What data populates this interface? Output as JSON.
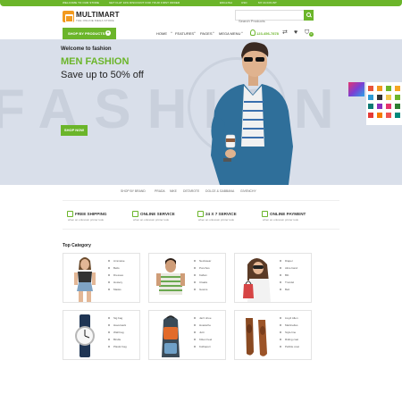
{
  "topbar": {
    "welcome": "WELCOME TO OUR STORE",
    "promo": "GET FLAT 10% DISCOUNT FOR YOUR FIRST ORDER",
    "language": "ENGLISH",
    "currency": "USD",
    "account": "MY ACCOUNT"
  },
  "header": {
    "logo_name": "MULTIMART",
    "logo_tagline": "THE ONLINE MEGA STORE",
    "search_placeholder": "Search Products"
  },
  "nav": {
    "shop_button": "SHOP BY PRODUCTS",
    "items": [
      "HOME",
      "FEATURES",
      "PAGES",
      "MEGA MENU"
    ],
    "phone": "123-456-7878",
    "cart_count": "0"
  },
  "hero": {
    "watermark": "FASHION",
    "welcome": "Welcome to fashion",
    "title": "MEN FASHION",
    "subtitle": "Save up to 50% off",
    "button": "SHOP NOW"
  },
  "swatches": [
    "#e8533a",
    "#f29a1f",
    "#6bb52a",
    "#f5a623",
    "#2b9bd6",
    "#333333",
    "#f2c94c",
    "#6bb52a",
    "#0b7a75",
    "#8b2fbf",
    "#e5346e",
    "#2e7d32",
    "#e53935",
    "#f57c00",
    "#ef5350",
    "#00897b"
  ],
  "brands": [
    "SHOP BY BRAND",
    "PRADA",
    "NIKE",
    "DETAROTE",
    "DOLCE & GABBANA",
    "GIVENCHY"
  ],
  "services": [
    {
      "title": "FREE SHIPPING",
      "subtitle": "when an unknown printer took"
    },
    {
      "title": "ONLINE SERVICE",
      "subtitle": "when an unknown printer took"
    },
    {
      "title": "24 X 7 SERVICE",
      "subtitle": "when an unknown printer took"
    },
    {
      "title": "ONLINE PAYMENT",
      "subtitle": "when an unknown printer took"
    }
  ],
  "top_category": {
    "heading": "Top Category",
    "cards": [
      {
        "image": "woman-denim-shorts",
        "items": [
          "Ammaise",
          "Belts",
          "Dresses",
          "Hosiery",
          "Masks"
        ]
      },
      {
        "image": "man-striped-tshirt",
        "items": [
          "Neckwear",
          "Ponchos",
          "Kaftan",
          "Cloaks",
          "Gowns"
        ]
      },
      {
        "image": "woman-shopping-bag",
        "items": [
          "Diaper",
          "Alice band",
          "Bib",
          "Trundel",
          "Belt"
        ]
      },
      {
        "image": "wrist-watch",
        "items": [
          "Sig bag",
          "Haversack",
          "Wall bag",
          "Bindle",
          "Plastic bag"
        ]
      },
      {
        "image": "backpack",
        "items": [
          "Jazz shoe",
          "Huarache",
          "Jutti",
          "Kitten heel",
          "Kolhapuri"
        ]
      },
      {
        "image": "brown-leather-shoes",
        "items": [
          "Lloyd Allen",
          "Martinelles",
          "Style line",
          "Riding coat",
          "Pebble coat"
        ]
      }
    ]
  }
}
